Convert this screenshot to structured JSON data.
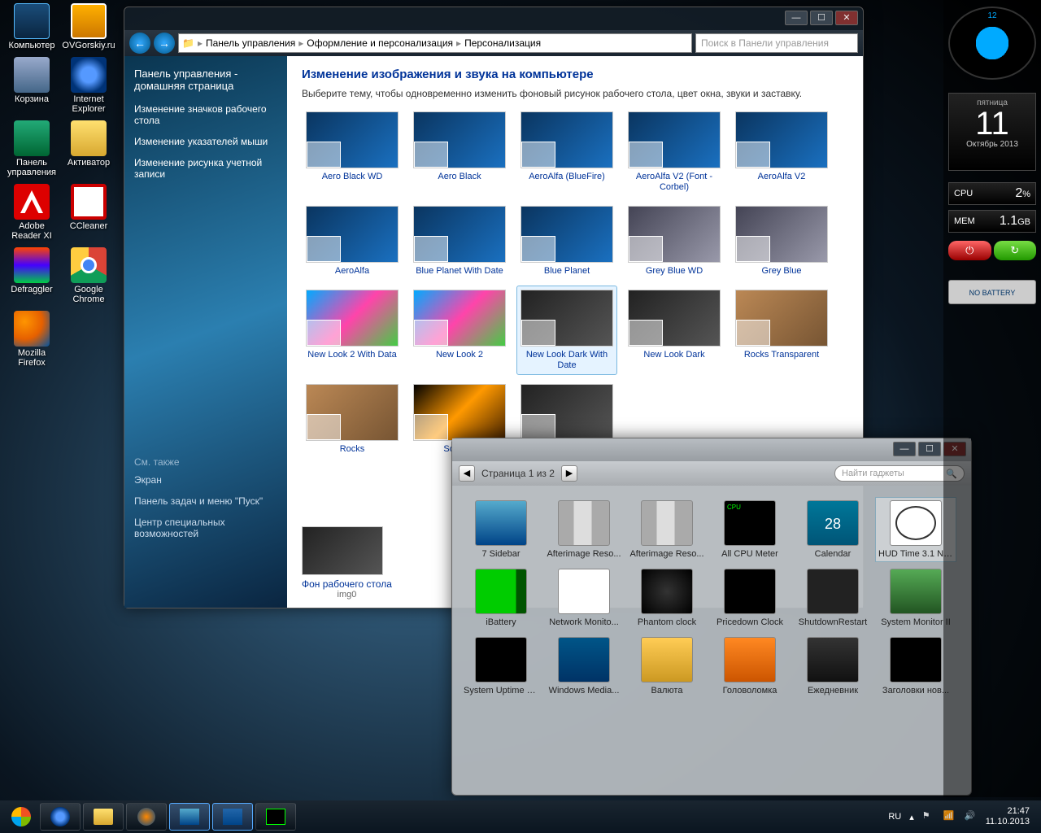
{
  "desktop": {
    "icons": [
      {
        "label": "Компьютер",
        "cls": "ico-computer"
      },
      {
        "label": "OVGorskiy.ru",
        "cls": "ico-ovg"
      },
      {
        "label": "Корзина",
        "cls": "ico-bin"
      },
      {
        "label": "Internet Explorer",
        "cls": "ico-ie"
      },
      {
        "label": "Панель управления",
        "cls": "ico-cp"
      },
      {
        "label": "Активатор",
        "cls": "ico-folder"
      },
      {
        "label": "Adobe Reader XI",
        "cls": "ico-adobe"
      },
      {
        "label": "CCleaner",
        "cls": "ico-cc"
      },
      {
        "label": "Defraggler",
        "cls": "ico-def"
      },
      {
        "label": "Google Chrome",
        "cls": "ico-chrome"
      },
      {
        "label": "Mozilla Firefox",
        "cls": "ico-ff"
      }
    ]
  },
  "win1": {
    "breadcrumb": [
      "Панель управления",
      "Оформление и персонализация",
      "Персонализация"
    ],
    "search_ph": "Поиск в Панели управления",
    "sidebar": {
      "head": "Панель управления - домашняя страница",
      "links": [
        "Изменение значков рабочего стола",
        "Изменение указателей мыши",
        "Изменение рисунка учетной записи"
      ],
      "seealso_t": "См. также",
      "seealso": [
        "Экран",
        "Панель задач и меню \"Пуск\"",
        "Центр специальных возможностей"
      ]
    },
    "title": "Изменение изображения и звука на компьютере",
    "subtitle": "Выберите тему, чтобы одновременно изменить фоновый рисунок рабочего стола, цвет окна, звуки и заставку.",
    "themes": [
      {
        "label": "Aero Black WD",
        "v": ""
      },
      {
        "label": "Aero Black",
        "v": ""
      },
      {
        "label": "AeroAlfa (BlueFire)",
        "v": ""
      },
      {
        "label": "AeroAlfa V2 (Font - Corbel)",
        "v": ""
      },
      {
        "label": "AeroAlfa V2",
        "v": ""
      },
      {
        "label": "AeroAlfa",
        "v": ""
      },
      {
        "label": "Blue Planet With Date",
        "v": ""
      },
      {
        "label": "Blue Planet",
        "v": ""
      },
      {
        "label": "Grey Blue WD",
        "v": "grey"
      },
      {
        "label": "Grey Blue",
        "v": "grey"
      },
      {
        "label": "New Look 2 With Data",
        "v": "multi"
      },
      {
        "label": "New Look 2",
        "v": "multi"
      },
      {
        "label": "New Look Dark With Date",
        "v": "dark",
        "sel": true
      },
      {
        "label": "New Look Dark",
        "v": "dark"
      },
      {
        "label": "Rocks Transparent",
        "v": "rock"
      },
      {
        "label": "Rocks",
        "v": "rock"
      },
      {
        "label": "Soft B...",
        "v": "fire"
      },
      {
        "label": "",
        "v": "dark"
      }
    ],
    "bg_label": "Фон рабочего стола",
    "bg_name": "img0"
  },
  "win2": {
    "page_text": "Страница 1 из 2",
    "search_ph": "Найти гаджеты",
    "gadgets": [
      {
        "label": "7 Sidebar",
        "c": "gi-7"
      },
      {
        "label": "Afterimage Reso...",
        "c": "gi-after"
      },
      {
        "label": "Afterimage Reso...",
        "c": "gi-after"
      },
      {
        "label": "All CPU Meter",
        "c": "gi-cpu"
      },
      {
        "label": "Calendar",
        "c": "gi-cal",
        "txt": "28"
      },
      {
        "label": "HUD Time 3.1 Ne...",
        "c": "gi-clock",
        "sel": true
      },
      {
        "label": "iBattery",
        "c": "gi-bat"
      },
      {
        "label": "Network Monito...",
        "c": "gi-net"
      },
      {
        "label": "Phantom clock",
        "c": "gi-pclock"
      },
      {
        "label": "Pricedown Clock",
        "c": "gi-price"
      },
      {
        "label": "ShutdownRestart",
        "c": "gi-shut"
      },
      {
        "label": "System Monitor II",
        "c": "gi-sys"
      },
      {
        "label": "System Uptime F...",
        "c": "gi-up"
      },
      {
        "label": "Windows Media...",
        "c": "gi-wmc"
      },
      {
        "label": "Валюта",
        "c": "gi-cur"
      },
      {
        "label": "Головоломка",
        "c": "gi-puz"
      },
      {
        "label": "Ежедневник",
        "c": "gi-diary"
      },
      {
        "label": "Заголовки нов...",
        "c": "gi-news"
      }
    ]
  },
  "gadside": {
    "cal_dow": "пятница",
    "cal_day": "11",
    "cal_my": "Октябрь 2013",
    "cpu_l": "CPU",
    "cpu_v": "2",
    "cpu_u": "%",
    "mem_l": "MEM",
    "mem_v": "1.1",
    "mem_u": "GB",
    "bat": "NO BATTERY"
  },
  "taskbar": {
    "lang": "RU",
    "time": "21:47",
    "date": "11.10.2013"
  }
}
